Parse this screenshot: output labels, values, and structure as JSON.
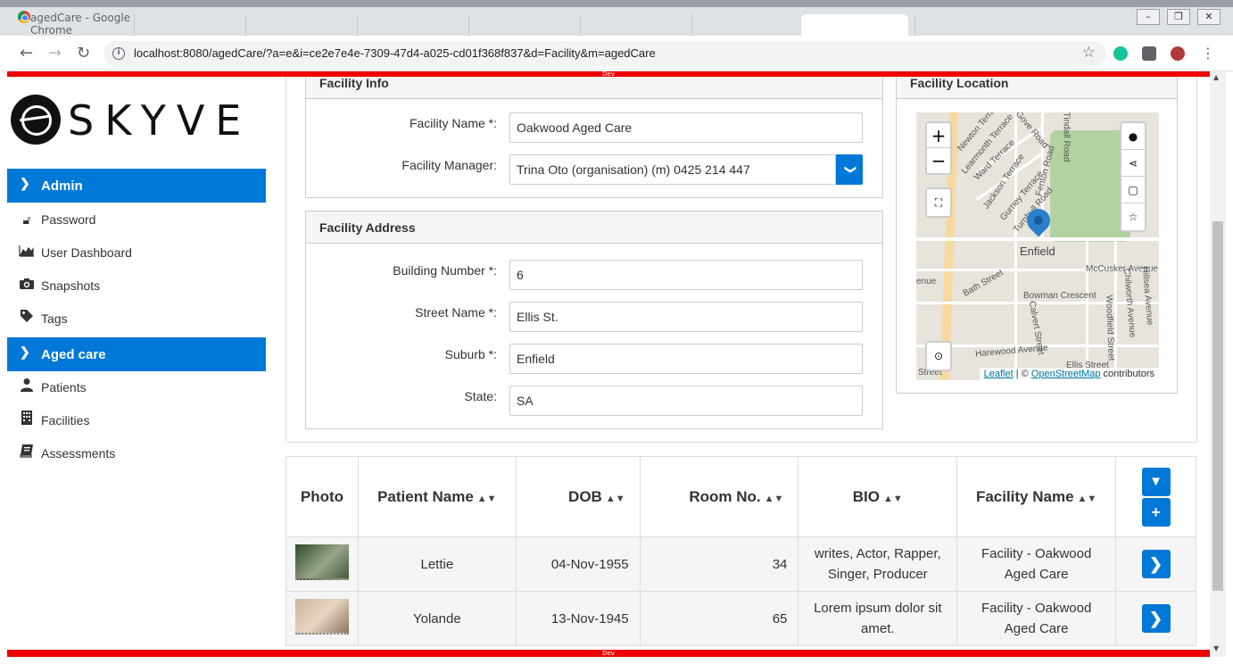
{
  "browser": {
    "window_title": "agedCare - Google Chrome",
    "url": "localhost:8080/agedCare/?a=e&i=ce2e7e4e-7309-47d4-a025-cd01f368f837&d=Facility&m=agedCare",
    "minimize": "–",
    "restore": "❐",
    "close": "✕"
  },
  "dev_banner": "Dev",
  "brand": {
    "logo_text": "SKYVE"
  },
  "sidebar": {
    "groups": [
      {
        "label": "Admin",
        "items": [
          {
            "label": "Password",
            "icon": "lock-icon"
          },
          {
            "label": "User Dashboard",
            "icon": "area-chart-icon"
          },
          {
            "label": "Snapshots",
            "icon": "camera-icon"
          },
          {
            "label": "Tags",
            "icon": "tag-icon"
          }
        ]
      },
      {
        "label": "Aged care",
        "items": [
          {
            "label": "Patients",
            "icon": "user-icon"
          },
          {
            "label": "Facilities",
            "icon": "building-icon"
          },
          {
            "label": "Assessments",
            "icon": "book-icon"
          }
        ]
      }
    ]
  },
  "facility_info": {
    "title": "Facility Info",
    "name_label": "Facility Name *:",
    "name_value": "Oakwood Aged Care",
    "manager_label": "Facility Manager:",
    "manager_value": "Trina Oto (organisation) (m) 0425 214 447"
  },
  "facility_address": {
    "title": "Facility Address",
    "building_label": "Building Number *:",
    "building_value": "6",
    "street_label": "Street Name *:",
    "street_value": "Ellis St.",
    "suburb_label": "Suburb *:",
    "suburb_value": "Enfield",
    "state_label": "State:",
    "state_value": "SA"
  },
  "facility_location": {
    "title": "Facility Location",
    "zoom_in": "+",
    "zoom_out": "−",
    "place_label": "Enfield",
    "street_labels": [
      "Newton Terrace",
      "Gove Road",
      "Tindall Road",
      "Learmonth Terrace",
      "Ward Terrace",
      "Jackson Terrace",
      "Fenton Road",
      "Gurney Terrace",
      "Turnbull Road",
      "McCusker Avenue",
      "Bath Street",
      "Bowman Crescent",
      "Calvert Street",
      "Woodfield Street",
      "Chilworth Avenue",
      "Hillsea Avenue",
      "Harewood Avenue",
      "Ellis Street",
      "Street",
      "enue",
      "Cr"
    ],
    "attribution_leaflet": "Leaflet",
    "attribution_sep": " | © ",
    "attribution_osm": "OpenStreetMap",
    "attribution_suffix": " contributors"
  },
  "patients_table": {
    "columns": [
      "Photo",
      "Patient Name",
      "DOB",
      "Room No.",
      "BIO",
      "Facility Name"
    ],
    "rows": [
      {
        "name": "Lettie",
        "dob": "04-Nov-1955",
        "room": "34",
        "bio": "writes, Actor, Rapper, Singer, Producer",
        "facility": "Facility - Oakwood Aged Care"
      },
      {
        "name": "Yolande",
        "dob": "13-Nov-1945",
        "room": "65",
        "bio": "Lorem ipsum dolor sit amet.",
        "facility": "Facility - Oakwood Aged Care"
      }
    ]
  },
  "colors": {
    "accent": "#0078d7",
    "dev_banner": "#ee0000"
  }
}
